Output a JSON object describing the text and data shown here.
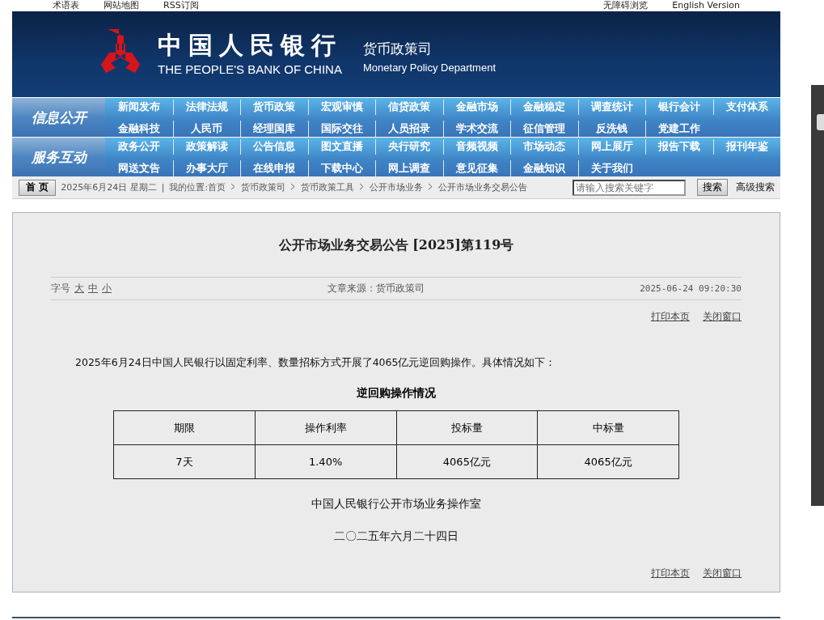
{
  "top_links": {
    "left": [
      "术语表",
      "网站地图",
      "RSS订阅"
    ],
    "right": [
      "无障碍浏览",
      "English Version"
    ]
  },
  "header": {
    "bank_cn": "中国人民银行",
    "bank_en": "THE PEOPLE'S BANK OF CHINA",
    "dept_cn": "货币政策司",
    "dept_en": "Monetary Policy Department"
  },
  "nav": [
    {
      "title": "信息公开",
      "rows": [
        [
          "新闻发布",
          "法律法规",
          "货币政策",
          "宏观审慎",
          "信贷政策",
          "金融市场",
          "金融稳定",
          "调查统计",
          "银行会计",
          "支付体系"
        ],
        [
          "金融科技",
          "人民币",
          "经理国库",
          "国际交往",
          "人员招录",
          "学术交流",
          "征信管理",
          "反洗钱",
          "党建工作"
        ]
      ]
    },
    {
      "title": "服务互动",
      "rows": [
        [
          "政务公开",
          "政策解读",
          "公告信息",
          "图文直播",
          "央行研究",
          "音频视频",
          "市场动态",
          "网上展厅",
          "报告下载",
          "报刊年鉴"
        ],
        [
          "网送文告",
          "办事大厅",
          "在线申报",
          "下载中心",
          "网上调查",
          "意见征集",
          "金融知识",
          "关于我们"
        ]
      ]
    }
  ],
  "breadcrumb": {
    "home_button": "首 页",
    "date": "2025年6月24日  星期二",
    "separator": "|",
    "location": "我的位置:首页",
    "path": [
      "货币政策司",
      "货币政策工具",
      "公开市场业务",
      "公开市场业务交易公告"
    ],
    "search_placeholder": "请输入搜索关键字",
    "search_button": "搜索",
    "advanced": "高级搜索"
  },
  "article": {
    "title": "公开市场业务交易公告 [2025]第119号",
    "font_label": "字号",
    "font_sizes": [
      "大",
      "中",
      "小"
    ],
    "source": "文章来源：货币政策司",
    "datetime": "2025-06-24 09:20:30",
    "actions_top": [
      "打印本页",
      "关闭窗口"
    ],
    "intro": "2025年6月24日中国人民银行以固定利率、数量招标方式开展了4065亿元逆回购操作。具体情况如下：",
    "table_title": "逆回购操作情况",
    "table": {
      "columns": [
        "期限",
        "操作利率",
        "投标量",
        "中标量"
      ],
      "rows": [
        [
          "7天",
          "1.40%",
          "4065亿元",
          "4065亿元"
        ]
      ]
    },
    "signature": "中国人民银行公开市场业务操作室",
    "date": "二〇二五年六月二十四日",
    "actions_bottom": [
      "打印本页",
      "关闭窗口"
    ]
  }
}
